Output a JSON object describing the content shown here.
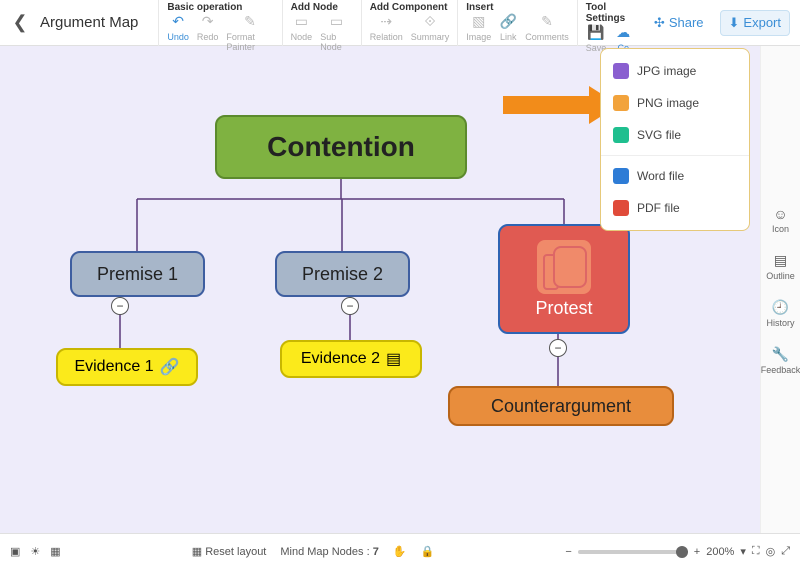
{
  "header": {
    "title": "Argument Map",
    "groups": {
      "basic": {
        "label": "Basic operation",
        "undo": "Undo",
        "redo": "Redo",
        "format": "Format Painter"
      },
      "addnode": {
        "label": "Add Node",
        "node": "Node",
        "subnode": "Sub Node"
      },
      "addcomp": {
        "label": "Add Component",
        "relation": "Relation",
        "summary": "Summary"
      },
      "insert": {
        "label": "Insert",
        "image": "Image",
        "link": "Link",
        "comments": "Comments"
      },
      "tool": {
        "label": "Tool Settings",
        "save": "Save",
        "co": "Co"
      }
    },
    "share": "Share",
    "export": "Export"
  },
  "export_menu": {
    "jpg": "JPG image",
    "png": "PNG image",
    "svg": "SVG file",
    "word": "Word file",
    "pdf": "PDF file"
  },
  "rail": {
    "icon": "Icon",
    "outline": "Outline",
    "history": "History",
    "feedback": "Feedback"
  },
  "nodes": {
    "contention": "Contention",
    "premise1": "Premise 1",
    "premise2": "Premise 2",
    "protest": "Protest",
    "evidence1": "Evidence 1",
    "evidence2": "Evidence 2",
    "counter": "Counterargument"
  },
  "status": {
    "reset": "Reset layout",
    "nodes_label": "Mind Map Nodes :",
    "nodes_count": "7",
    "zoom": "200%"
  },
  "colors": {
    "canvas_bg": "#eeecfa",
    "contention": "#7fb241",
    "premise": "#a7b6c9",
    "protest": "#e05a52",
    "evidence": "#fbea1b",
    "counter": "#e88d3c",
    "arrow": "#f28c1a"
  }
}
